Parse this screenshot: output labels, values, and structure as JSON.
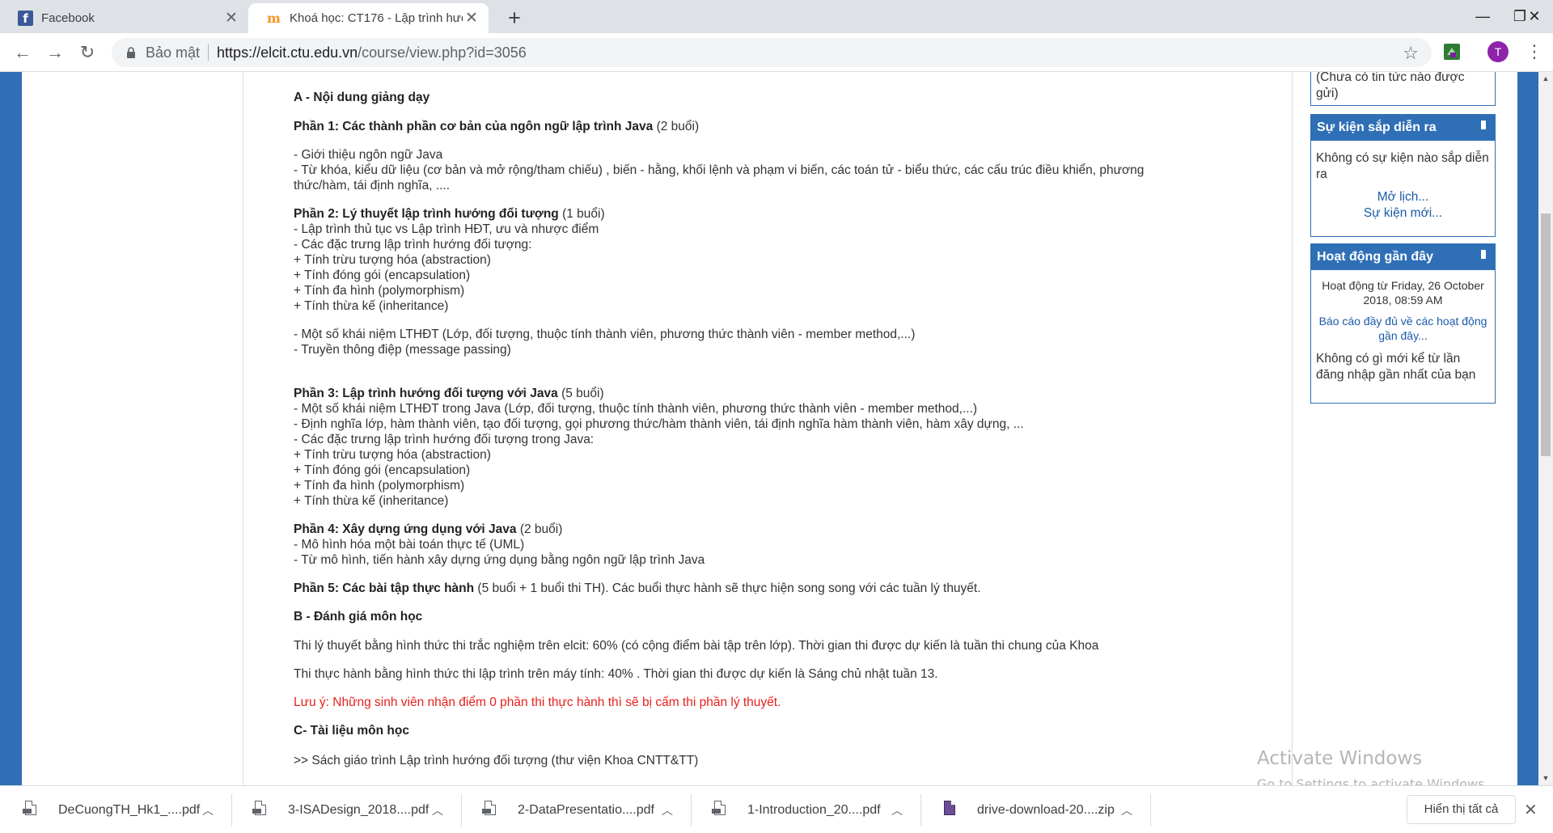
{
  "tabs": [
    {
      "title": "Facebook",
      "icon": "facebook-icon"
    },
    {
      "title": "Khoá học: CT176 - Lập trình hướ",
      "icon": "moodle-icon"
    }
  ],
  "window_controls": {
    "minimize": "—",
    "restore": "❐",
    "close": "✕"
  },
  "toolbar": {
    "secure_label": "Bảo mật",
    "url_host": "https://elcit.ctu.edu.vn",
    "url_path": "/course/view.php?id=3056",
    "avatar_letter": "T"
  },
  "content": {
    "sec_a": "A - Nội dung giảng dạy",
    "p1_title": "Phần 1: Các thành phần cơ bản của ngôn ngữ lập trình Java",
    "p1_sessions": "(2 buổi)",
    "p1_l1": "  - Giới thiệu ngôn  ngữ Java",
    "p1_l2": "  - Từ khóa, kiểu dữ liệu (cơ bản và mở rộng/tham chiếu) , biến - hằng, khối lệnh và phạm vi biến, các toán tử - biểu thức, các cấu trúc điều khiển, phương",
    "p1_l3": "thức/hàm, tái định nghĩa, ....",
    "p2_title": "Phần 2: Lý thuyết lập trình hướng đối tượng",
    "p2_sessions": "(1 buổi)",
    "p2_l1": "  - Lập trình thủ tục vs Lập trình HĐT, ưu và nhược điểm",
    "p2_l2": "  - Các đặc trưng lập trình hướng đối tượng:",
    "p2_l3": "    + Tính trừu tượng hóa (abstraction)",
    "p2_l4": "    + Tính đóng gói (encapsulation)",
    "p2_l5": "    + Tính đa hình (polymorphism)",
    "p2_l6": "    + Tính thừa kế (inheritance)",
    "p2_l7": "   - Một số khái niệm LTHĐT (Lớp, đối tượng, thuộc tính thành viên, phương thức thành viên - member method,...)",
    "p2_l8": "   - Truyền thông điệp (message passing)",
    "p3_title": "Phần 3: Lập trình hướng đối tượng với Java",
    "p3_sessions": "(5 buổi)",
    "p3_l1": "  - Một số khái niệm LTHĐT trong Java (Lớp, đối tượng, thuộc tính thành viên, phương thức thành viên - member method,...)",
    "p3_l2": "  - Định nghĩa lớp, hàm thành viên, tạo đối tượng, gọi phương thức/hàm thành viên, tái định nghĩa hàm thành viên, hàm xây dựng, ...",
    "p3_l3": "  - Các đặc trưng lập trình hướng đối tượng trong Java:",
    "p3_l4": "   + Tính trừu tượng hóa (abstraction)",
    "p3_l5": "   + Tính đóng gói (encapsulation)",
    "p3_l6": "   + Tính đa hình (polymorphism)",
    "p3_l7": "   + Tính thừa kế (inheritance)",
    "p4_title": "Phần 4: Xây dựng ứng dụng với Java",
    "p4_sessions": "(2 buổi)",
    "p4_l1": "  - Mô hình hóa một bài toán thực tế (UML)",
    "p4_l2": "  - Từ mô hình, tiến hành xây dựng ứng dụng bằng ngôn ngữ lập trình Java",
    "p5_title": "Phần 5: Các bài tập thực hành",
    "p5_rest": "(5 buổi + 1 buổi thi TH). Các buổi thực hành sẽ thực hiện song song với các tuần lý thuyết.",
    "sec_b": "B - Đánh giá môn học",
    "b_l1": " Thi lý thuyết bằng hình thức thi trắc nghiệm trên elcit: 60% (có cộng điểm bài tập trên lớp). Thời gian thi được dự kiến là tuần thi chung của Khoa",
    "b_l2": " Thi thực hành bằng hình thức thi lập trình trên máy tính: 40% . Thời gian thi được dự kiến là Sáng chủ nhật tuần 13.",
    "warning": "Lưu ý: Những sinh viên nhận điểm 0 phần thi thực hành thì sẽ bị cấm thi phần lý thuyết.",
    "sec_c": "C- Tài liệu môn học",
    "c_l1": "   >> Sách giáo trình Lập trình hướng đối tượng (thư viện Khoa CNTT&TT)"
  },
  "sidebar": {
    "news_text": "(Chưa có tin tức nào được gửi)",
    "events_title": "Sự kiện sắp diễn ra",
    "events_text": "Không có sự kiện nào sắp diễn ra",
    "events_link1": "Mở lịch...",
    "events_link2": "Sự kiện mới...",
    "activity_title": "Hoạt động gần đây",
    "activity_since": "Hoạt động từ Friday, 26 October 2018, 08:59 AM",
    "activity_report": "Báo cáo đầy đủ về các hoạt động gần đây...",
    "activity_text": "Không có gì mới kể từ lần đăng nhập gần nhất của bạn"
  },
  "watermark": {
    "line1": "Activate Windows",
    "line2": "Go to Settings to activate Windows."
  },
  "downloads": [
    {
      "name": "DeCuongTH_Hk1_....pdf",
      "type": "pdf"
    },
    {
      "name": "3-ISADesign_2018....pdf",
      "type": "pdf"
    },
    {
      "name": "2-DataPresentatio....pdf",
      "type": "pdf"
    },
    {
      "name": "1-Introduction_20....pdf",
      "type": "pdf"
    },
    {
      "name": "drive-download-20....zip",
      "type": "zip"
    }
  ],
  "shelf": {
    "show_all": "Hiển thị tất cả"
  }
}
